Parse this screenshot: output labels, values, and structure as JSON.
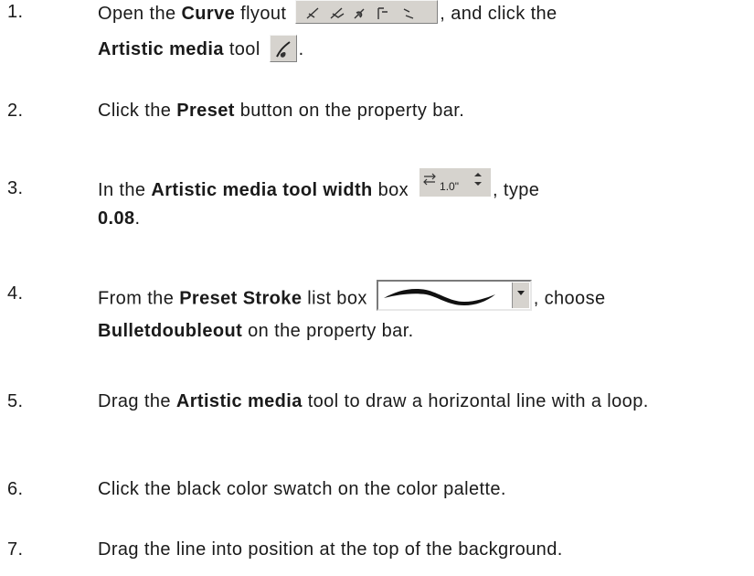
{
  "steps": [
    {
      "number": "1.",
      "t1": "Open the ",
      "b1": "Curve",
      "t2": " flyout ",
      "t3": ", and click the",
      "b2": "Artistic media",
      "t4": " tool ",
      "t5": "."
    },
    {
      "number": "2.",
      "t1": "Click the ",
      "b1": "Preset",
      "t2": " button on the property bar."
    },
    {
      "number": "3.",
      "t1": "In the ",
      "b1": "Artistic media tool width",
      "t2": " box ",
      "width_value": "1.0\"",
      "t3": ", type",
      "b2": "0.08",
      "t4": "."
    },
    {
      "number": "4.",
      "t1": "From the ",
      "b1": "Preset Stroke",
      "t2": " list box ",
      "t3": ", choose",
      "b2": "Bulletdoubleout",
      "t4": " on the property bar."
    },
    {
      "number": "5.",
      "t1": "Drag the ",
      "b1": "Artistic media",
      "t2": " tool to draw a horizontal line with a loop."
    },
    {
      "number": "6.",
      "t1": "Click the black color swatch on the color palette."
    },
    {
      "number": "7.",
      "t1": "Drag the line into position at the top of the background."
    }
  ],
  "icons": {
    "curve_flyout": "curve-flyout-icon",
    "artistic_media_tool": "artistic-media-tool-icon",
    "width_box": "width-box-icon",
    "preset_stroke": "preset-stroke-listbox"
  }
}
